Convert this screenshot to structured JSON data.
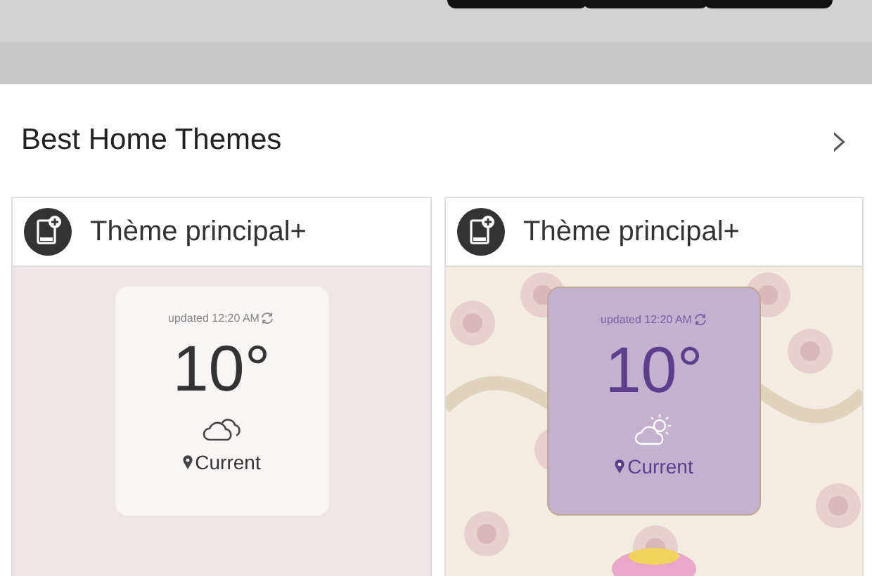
{
  "section": {
    "title": "Best Home Themes",
    "more": "›"
  },
  "themes": [
    {
      "name": "Thème principal+",
      "kind": "plain",
      "widget": {
        "updated": "updated 12:20 AM",
        "temperature": "10°",
        "location": "Current"
      }
    },
    {
      "name": "Thème principal+",
      "kind": "wallpaper",
      "widget": {
        "updated": "updated 12:20 AM",
        "temperature": "10°",
        "location": "Current"
      }
    }
  ]
}
